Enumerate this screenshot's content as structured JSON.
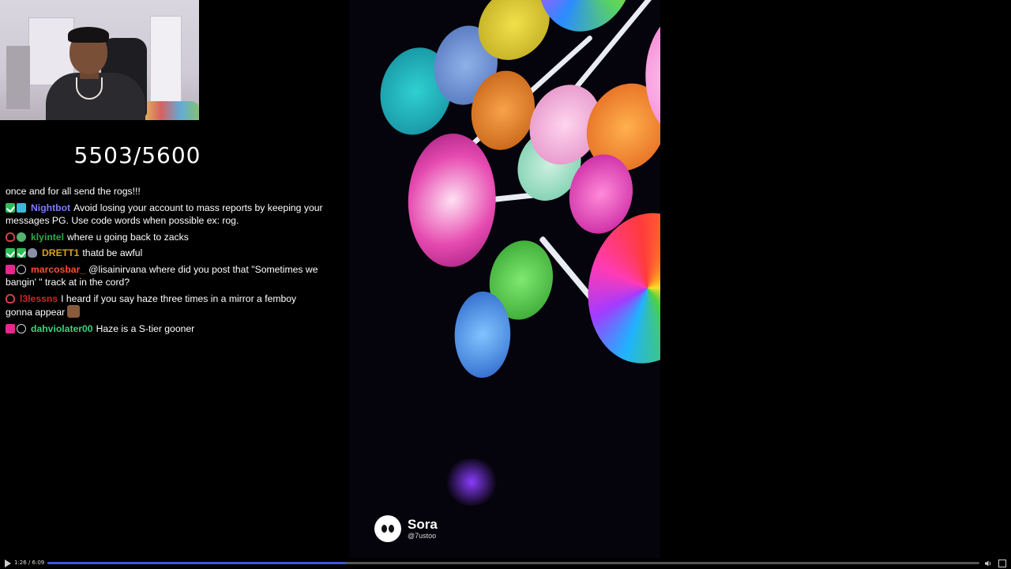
{
  "subgoal": {
    "text": "5503/5600"
  },
  "chat": {
    "messages": [
      {
        "user": "",
        "user_color": "#ffffff",
        "text": "once and for all send the rogs!!!"
      },
      {
        "user": "Nightbot",
        "user_color": "#7b7bff",
        "badges": [
          "green-check-badge",
          "bot-badge"
        ],
        "text": "Avoid losing your account to mass reports by keeping your messages PG. Use code words when possible ex: rog."
      },
      {
        "user": "klyintel",
        "user_color": "#2fa84a",
        "badges": [
          "fire-badge",
          "globe-badge"
        ],
        "text": "where u going back to zacks"
      },
      {
        "user": "DRETT1",
        "user_color": "#d9a21a",
        "badges": [
          "green-check-badge",
          "green-check-badge",
          "skull-badge"
        ],
        "text": "thatd be awful"
      },
      {
        "user": "marcosbar_",
        "user_color": "#ff4d2e",
        "badges": [
          "heart-badge",
          "drop-badge"
        ],
        "text": "@lisainirvana where did you post that \"Sometimes we bangin' \" track at in the cord?"
      },
      {
        "user": "l3lessns",
        "user_color": "#d22626",
        "badges": [
          "fire-badge"
        ],
        "text": "I heard if you say haze three times in a mirror a femboy gonna appear"
      },
      {
        "user": "dahviolater00",
        "user_color": "#3bd47a",
        "badges": [
          "heart-badge",
          "drop-badge"
        ],
        "text": "Haze is a S-tier gooner"
      }
    ]
  },
  "video": {
    "watermark_name": "Sora",
    "watermark_handle": "@7ustoo"
  },
  "player": {
    "time": "1:26 / 6:09",
    "progress": 0.32,
    "accent": "#3f57d9"
  }
}
